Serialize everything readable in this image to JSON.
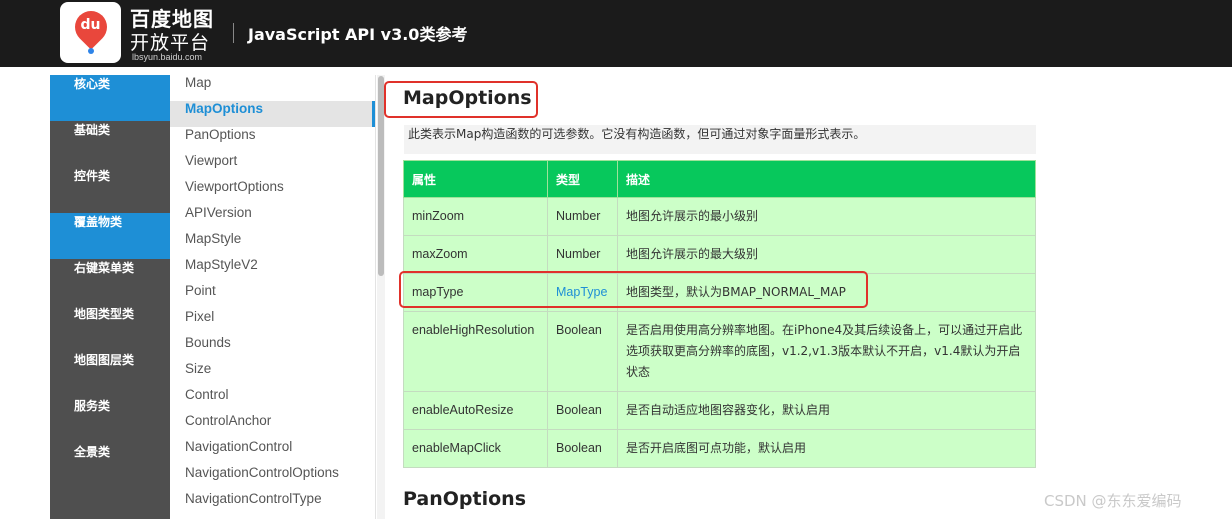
{
  "header": {
    "logo_mark": "du",
    "brand_name": "百度地图",
    "brand_sub": "开放平台",
    "brand_url": "lbsyun.baidu.com",
    "title": "JavaScript API v3.0类参考"
  },
  "categories": [
    {
      "label": "核心类",
      "active": true
    },
    {
      "label": "基础类",
      "active": false
    },
    {
      "label": "控件类",
      "active": false
    },
    {
      "label": "覆盖物类",
      "active": true
    },
    {
      "label": "右键菜单类",
      "active": false
    },
    {
      "label": "地图类型类",
      "active": false
    },
    {
      "label": "地图图层类",
      "active": false
    },
    {
      "label": "服务类",
      "active": false
    },
    {
      "label": "全景类",
      "active": false
    }
  ],
  "classes": [
    {
      "label": "Map"
    },
    {
      "label": "MapOptions",
      "active": true
    },
    {
      "label": "PanOptions"
    },
    {
      "label": "Viewport"
    },
    {
      "label": "ViewportOptions"
    },
    {
      "label": "APIVersion"
    },
    {
      "label": "MapStyle"
    },
    {
      "label": "MapStyleV2"
    },
    {
      "label": "Point"
    },
    {
      "label": "Pixel"
    },
    {
      "label": "Bounds"
    },
    {
      "label": "Size"
    },
    {
      "label": "Control"
    },
    {
      "label": "ControlAnchor"
    },
    {
      "label": "NavigationControl"
    },
    {
      "label": "NavigationControlOptions"
    },
    {
      "label": "NavigationControlType"
    }
  ],
  "main": {
    "heading": "MapOptions",
    "description": "此类表示Map构造函数的可选参数。它没有构造函数，但可通过对象字面量形式表示。",
    "table": {
      "headers": [
        "属性",
        "类型",
        "描述"
      ],
      "rows": [
        {
          "prop": "minZoom",
          "type": "Number",
          "desc": "地图允许展示的最小级别"
        },
        {
          "prop": "maxZoom",
          "type": "Number",
          "desc": "地图允许展示的最大级别"
        },
        {
          "prop": "mapType",
          "type": "MapType",
          "desc": "地图类型，默认为BMAP_NORMAL_MAP"
        },
        {
          "prop": "enableHighResolution",
          "type": "Boolean",
          "desc": "是否启用使用高分辨率地图。在iPhone4及其后续设备上，可以通过开启此选项获取更高分辨率的底图，v1.2,v1.3版本默认不开启，v1.4默认为开启状态"
        },
        {
          "prop": "enableAutoResize",
          "type": "Boolean",
          "desc": "是否自动适应地图容器变化，默认启用"
        },
        {
          "prop": "enableMapClick",
          "type": "Boolean",
          "desc": "是否开启底图可点功能，默认启用"
        }
      ]
    },
    "next_heading": "PanOptions"
  },
  "watermark": "CSDN @东东爱编码",
  "colors": {
    "header_bg": "#1b1b1b",
    "sidebar_bg": "#4f4f4f",
    "accent": "#1e8fd6",
    "table_header": "#07c85c",
    "table_bg": "#ccffc8",
    "highlight": "#e0312a"
  }
}
